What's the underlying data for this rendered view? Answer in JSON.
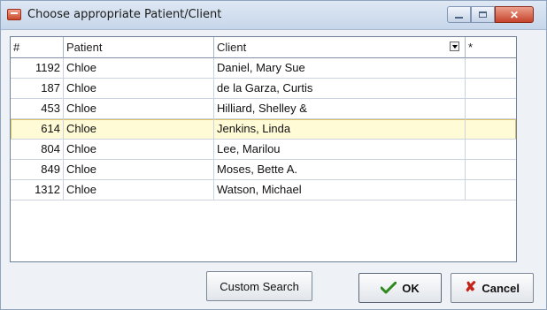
{
  "window": {
    "title": "Choose appropriate Patient/Client"
  },
  "columns": {
    "idx": "#",
    "patient": "Patient",
    "client": "Client",
    "extra": "*"
  },
  "rows": [
    {
      "id": "1192",
      "patient": "Chloe",
      "client": "Daniel, Mary Sue"
    },
    {
      "id": "187",
      "patient": "Chloe",
      "client": "de la Garza, Curtis"
    },
    {
      "id": "453",
      "patient": "Chloe",
      "client": "Hilliard, Shelley &"
    },
    {
      "id": "614",
      "patient": "Chloe",
      "client": "Jenkins, Linda"
    },
    {
      "id": "804",
      "patient": "Chloe",
      "client": "Lee, Marilou"
    },
    {
      "id": "849",
      "patient": "Chloe",
      "client": "Moses, Bette A."
    },
    {
      "id": "1312",
      "patient": "Chloe",
      "client": "Watson, Michael"
    }
  ],
  "selected_row": 3,
  "buttons": {
    "custom_search": "Custom Search",
    "ok": "OK",
    "cancel": "Cancel"
  },
  "icons": {
    "title": "app-icon",
    "ok": "check-icon",
    "cancel": "x-icon"
  },
  "colors": {
    "selection": "#fffbd6",
    "ok_check": "#2e8a1e",
    "cancel_x": "#c32418"
  }
}
